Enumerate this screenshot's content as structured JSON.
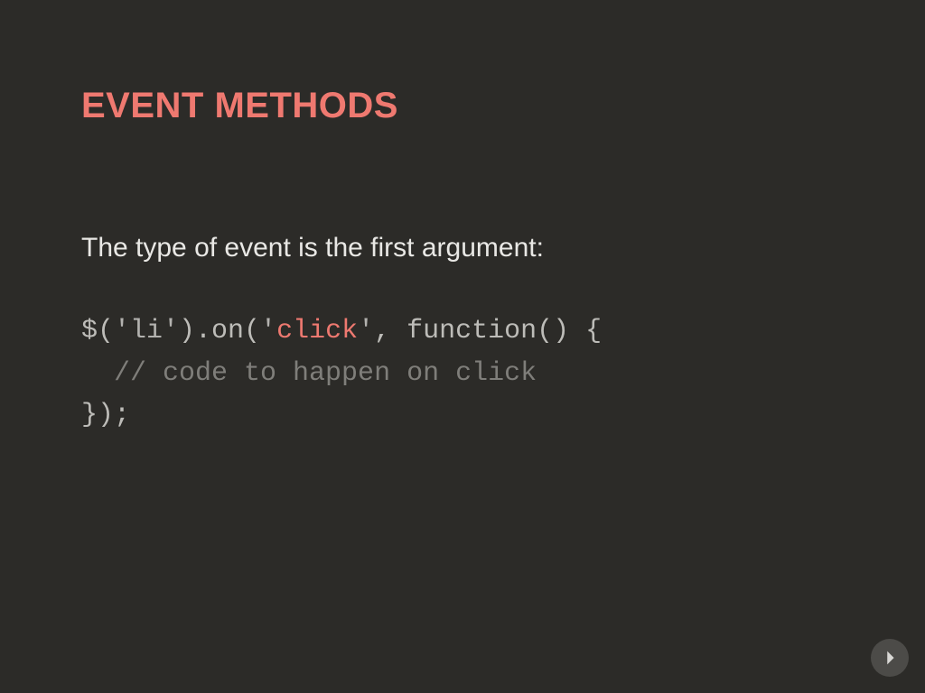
{
  "slide": {
    "title": "EVENT METHODS",
    "subtitle": "The type of event is the first argument:",
    "code": {
      "l1_pre": "$(",
      "l1_str": "'li'",
      "l1_mid": ").on(",
      "l1_arg_open": "'",
      "l1_arg": "click",
      "l1_arg_close": "'",
      "l1_post": ", function() {",
      "l2_indent": "  ",
      "l2_comment": "// code to happen on click",
      "l3": "});"
    }
  },
  "nav": {
    "next_label": "next-slide"
  }
}
